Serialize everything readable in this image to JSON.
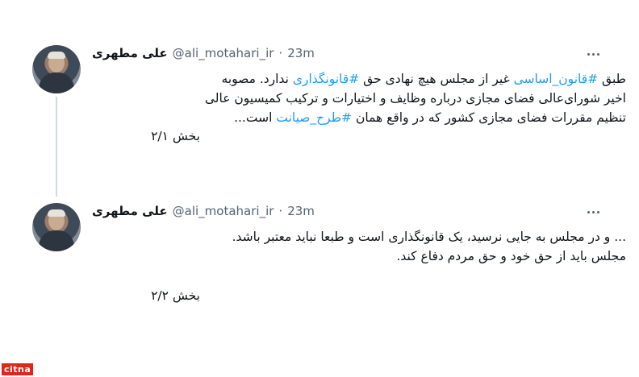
{
  "tweets": [
    {
      "name": "علی مطهری",
      "handle": "@ali_motahari_ir",
      "dot": "·",
      "time": "23m",
      "lines": [
        [
          "طبق ",
          "#قانون_اساسی",
          " غیر از مجلس هیچ نهادی حق ",
          "#قانونگذاری",
          " ندارد. مصوبه"
        ],
        [
          "اخیر شورای‌عالی فضای مجازی درباره وظایف و اختیارات و ترکیب کمیسیون عالی"
        ],
        [
          "تنظیم مقررات فضای مجازی کشور که در واقع همان ",
          "#طرح_صیانت",
          " است..."
        ]
      ],
      "part": "بخش ۲/۱"
    },
    {
      "name": "علی مطهری",
      "handle": "@ali_motahari_ir",
      "dot": "·",
      "time": "23m",
      "lines": [
        [
          "... و در مجلس به جایی نرسید، یک قانونگذاری است و طبعا نباید معتبر باشد."
        ],
        [
          "مجلس باید از حق خود و حق مردم دفاع کند."
        ]
      ],
      "part": "بخش ۲/۲"
    }
  ],
  "icons": {
    "more": "more-horizontal-icon",
    "avatar": "profile-photo"
  },
  "colors": {
    "hashtag": "#1d9bf0",
    "secondary": "#536471",
    "thread_line": "#cfd9de",
    "watermark": "#e0251b"
  },
  "watermark": "citna"
}
